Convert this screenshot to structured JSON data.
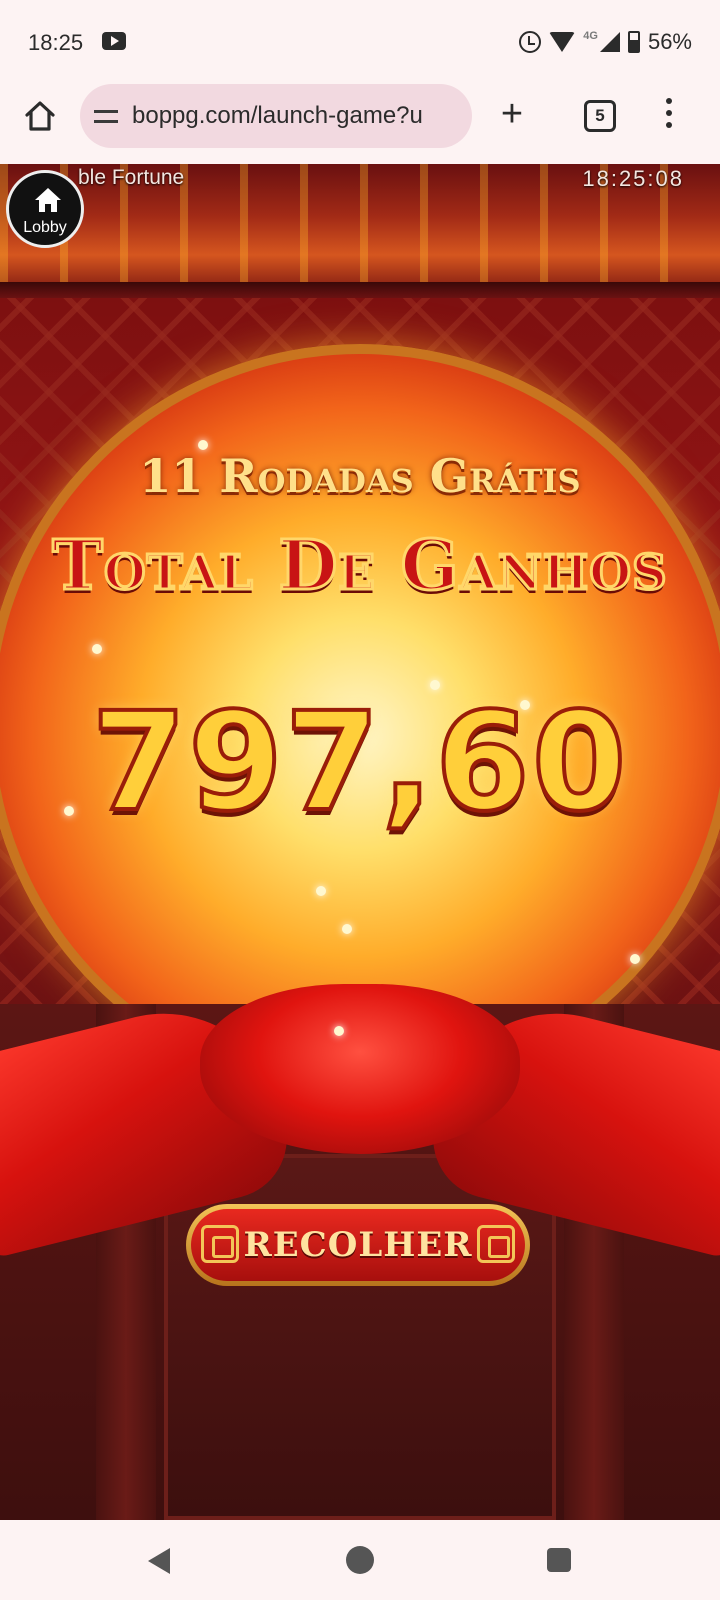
{
  "status_bar": {
    "time": "18:25",
    "network": "4G",
    "battery": "56%",
    "icons": [
      "youtube-icon",
      "alarm-icon",
      "wifi-icon",
      "signal-icon",
      "battery-icon"
    ]
  },
  "browser": {
    "url": "boppg.com/launch-game?u",
    "tab_count": "5",
    "icons": [
      "home-icon",
      "site-settings-icon",
      "new-tab-icon",
      "tab-switcher-icon",
      "more-menu-icon"
    ]
  },
  "game": {
    "lobby_label": "Lobby",
    "title": "ble Fortune",
    "clock": "18:25:08",
    "free_spins": "11 Rodadas Grátis",
    "total_label": "Total De Ganhos",
    "amount": "797,60",
    "collect_label": "RECOLHER",
    "colors": {
      "gold": "#ffcf3a",
      "red": "#c81414",
      "button_red": "#e8291f",
      "trim_gold": "#f3c558"
    }
  },
  "navbar": {
    "icons": [
      "back-icon",
      "home-circle-icon",
      "recents-icon"
    ]
  }
}
